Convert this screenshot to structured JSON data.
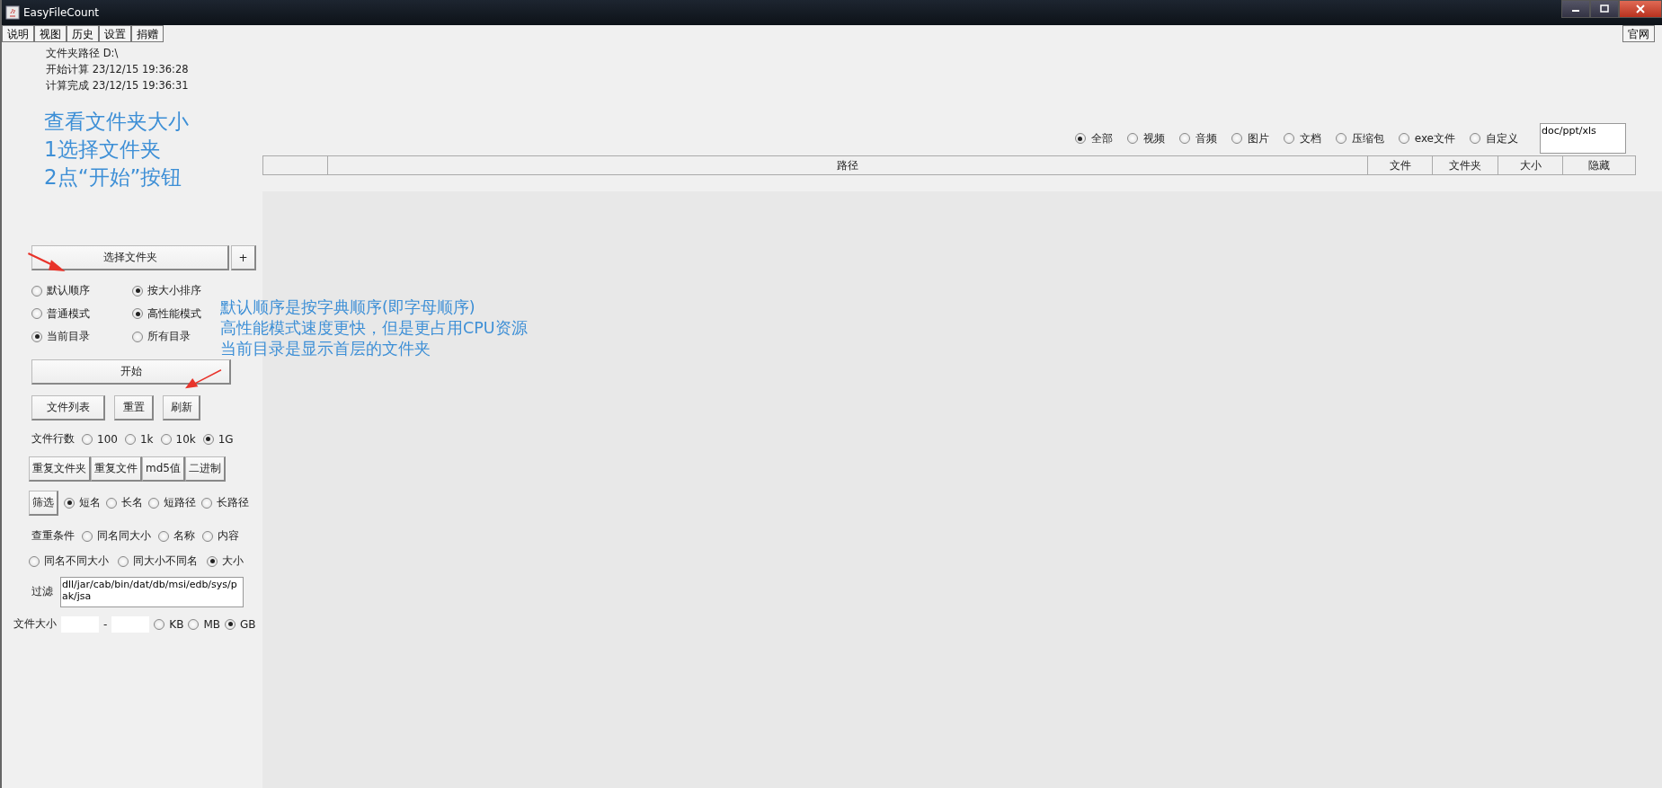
{
  "window": {
    "title": "EasyFileCount"
  },
  "menu": [
    "说明",
    "视图",
    "历史",
    "设置",
    "捐赠"
  ],
  "website_button": "官网",
  "info": [
    "文件夹路径 D:\\",
    "开始计算 23/12/15 19:36:28",
    "计算完成 23/12/15 19:36:31"
  ],
  "guide": [
    "查看文件夹大小",
    "1选择文件夹",
    "2点“开始”按钮"
  ],
  "select_folder": {
    "label": "选择文件夹",
    "plus": "+"
  },
  "option_groups": [
    [
      {
        "label": "默认顺序",
        "selected": false
      },
      {
        "label": "按大小排序",
        "selected": true
      }
    ],
    [
      {
        "label": "普通模式",
        "selected": false
      },
      {
        "label": "高性能模式",
        "selected": true
      }
    ],
    [
      {
        "label": "当前目录",
        "selected": true
      },
      {
        "label": "所有目录",
        "selected": false
      }
    ]
  ],
  "notes": [
    "默认顺序是按字典顺序(即字母顺序)",
    "高性能模式速度更快，但是更占用CPU资源",
    "当前目录是显示首层的文件夹"
  ],
  "start_button": "开始",
  "actions": [
    "文件列表",
    "重置",
    "刷新"
  ],
  "row_limit": {
    "label": "文件行数",
    "options": [
      {
        "label": "100",
        "selected": false
      },
      {
        "label": "1k",
        "selected": false
      },
      {
        "label": "10k",
        "selected": false
      },
      {
        "label": "1G",
        "selected": true
      }
    ]
  },
  "duplicate_buttons": [
    "重复文件夹",
    "重复文件",
    "md5值",
    "二进制"
  ],
  "filter": {
    "button": "筛选",
    "options": [
      {
        "label": "短名",
        "selected": true
      },
      {
        "label": "长名",
        "selected": false
      },
      {
        "label": "短路径",
        "selected": false
      },
      {
        "label": "长路径",
        "selected": false
      }
    ]
  },
  "duplicate_condition": {
    "label": "查重条件",
    "rows": [
      [
        {
          "label": "同名同大小",
          "selected": false
        },
        {
          "label": "名称",
          "selected": false
        },
        {
          "label": "内容",
          "selected": false
        }
      ],
      [
        {
          "label": "同名不同大小",
          "selected": false
        },
        {
          "label": "同大小不同名",
          "selected": false
        },
        {
          "label": "大小",
          "selected": true
        }
      ]
    ]
  },
  "exclude": {
    "label": "过滤",
    "value": "dll/jar/cab/bin/dat/db/msi/edb/sys/pak/jsa"
  },
  "file_size": {
    "label": "文件大小",
    "separator": "-",
    "units": [
      {
        "label": "KB",
        "selected": false
      },
      {
        "label": "MB",
        "selected": false
      },
      {
        "label": "GB",
        "selected": true
      }
    ]
  },
  "types": {
    "options": [
      {
        "label": "全部",
        "selected": true
      },
      {
        "label": "视频",
        "selected": false
      },
      {
        "label": "音频",
        "selected": false
      },
      {
        "label": "图片",
        "selected": false
      },
      {
        "label": "文档",
        "selected": false
      },
      {
        "label": "压缩包",
        "selected": false
      },
      {
        "label": "exe文件",
        "selected": false
      },
      {
        "label": "自定义",
        "selected": false
      }
    ],
    "custom_value": "doc/ppt/xls"
  },
  "table": {
    "columns": [
      "路径",
      "文件",
      "文件夹",
      "大小",
      "隐藏"
    ]
  }
}
